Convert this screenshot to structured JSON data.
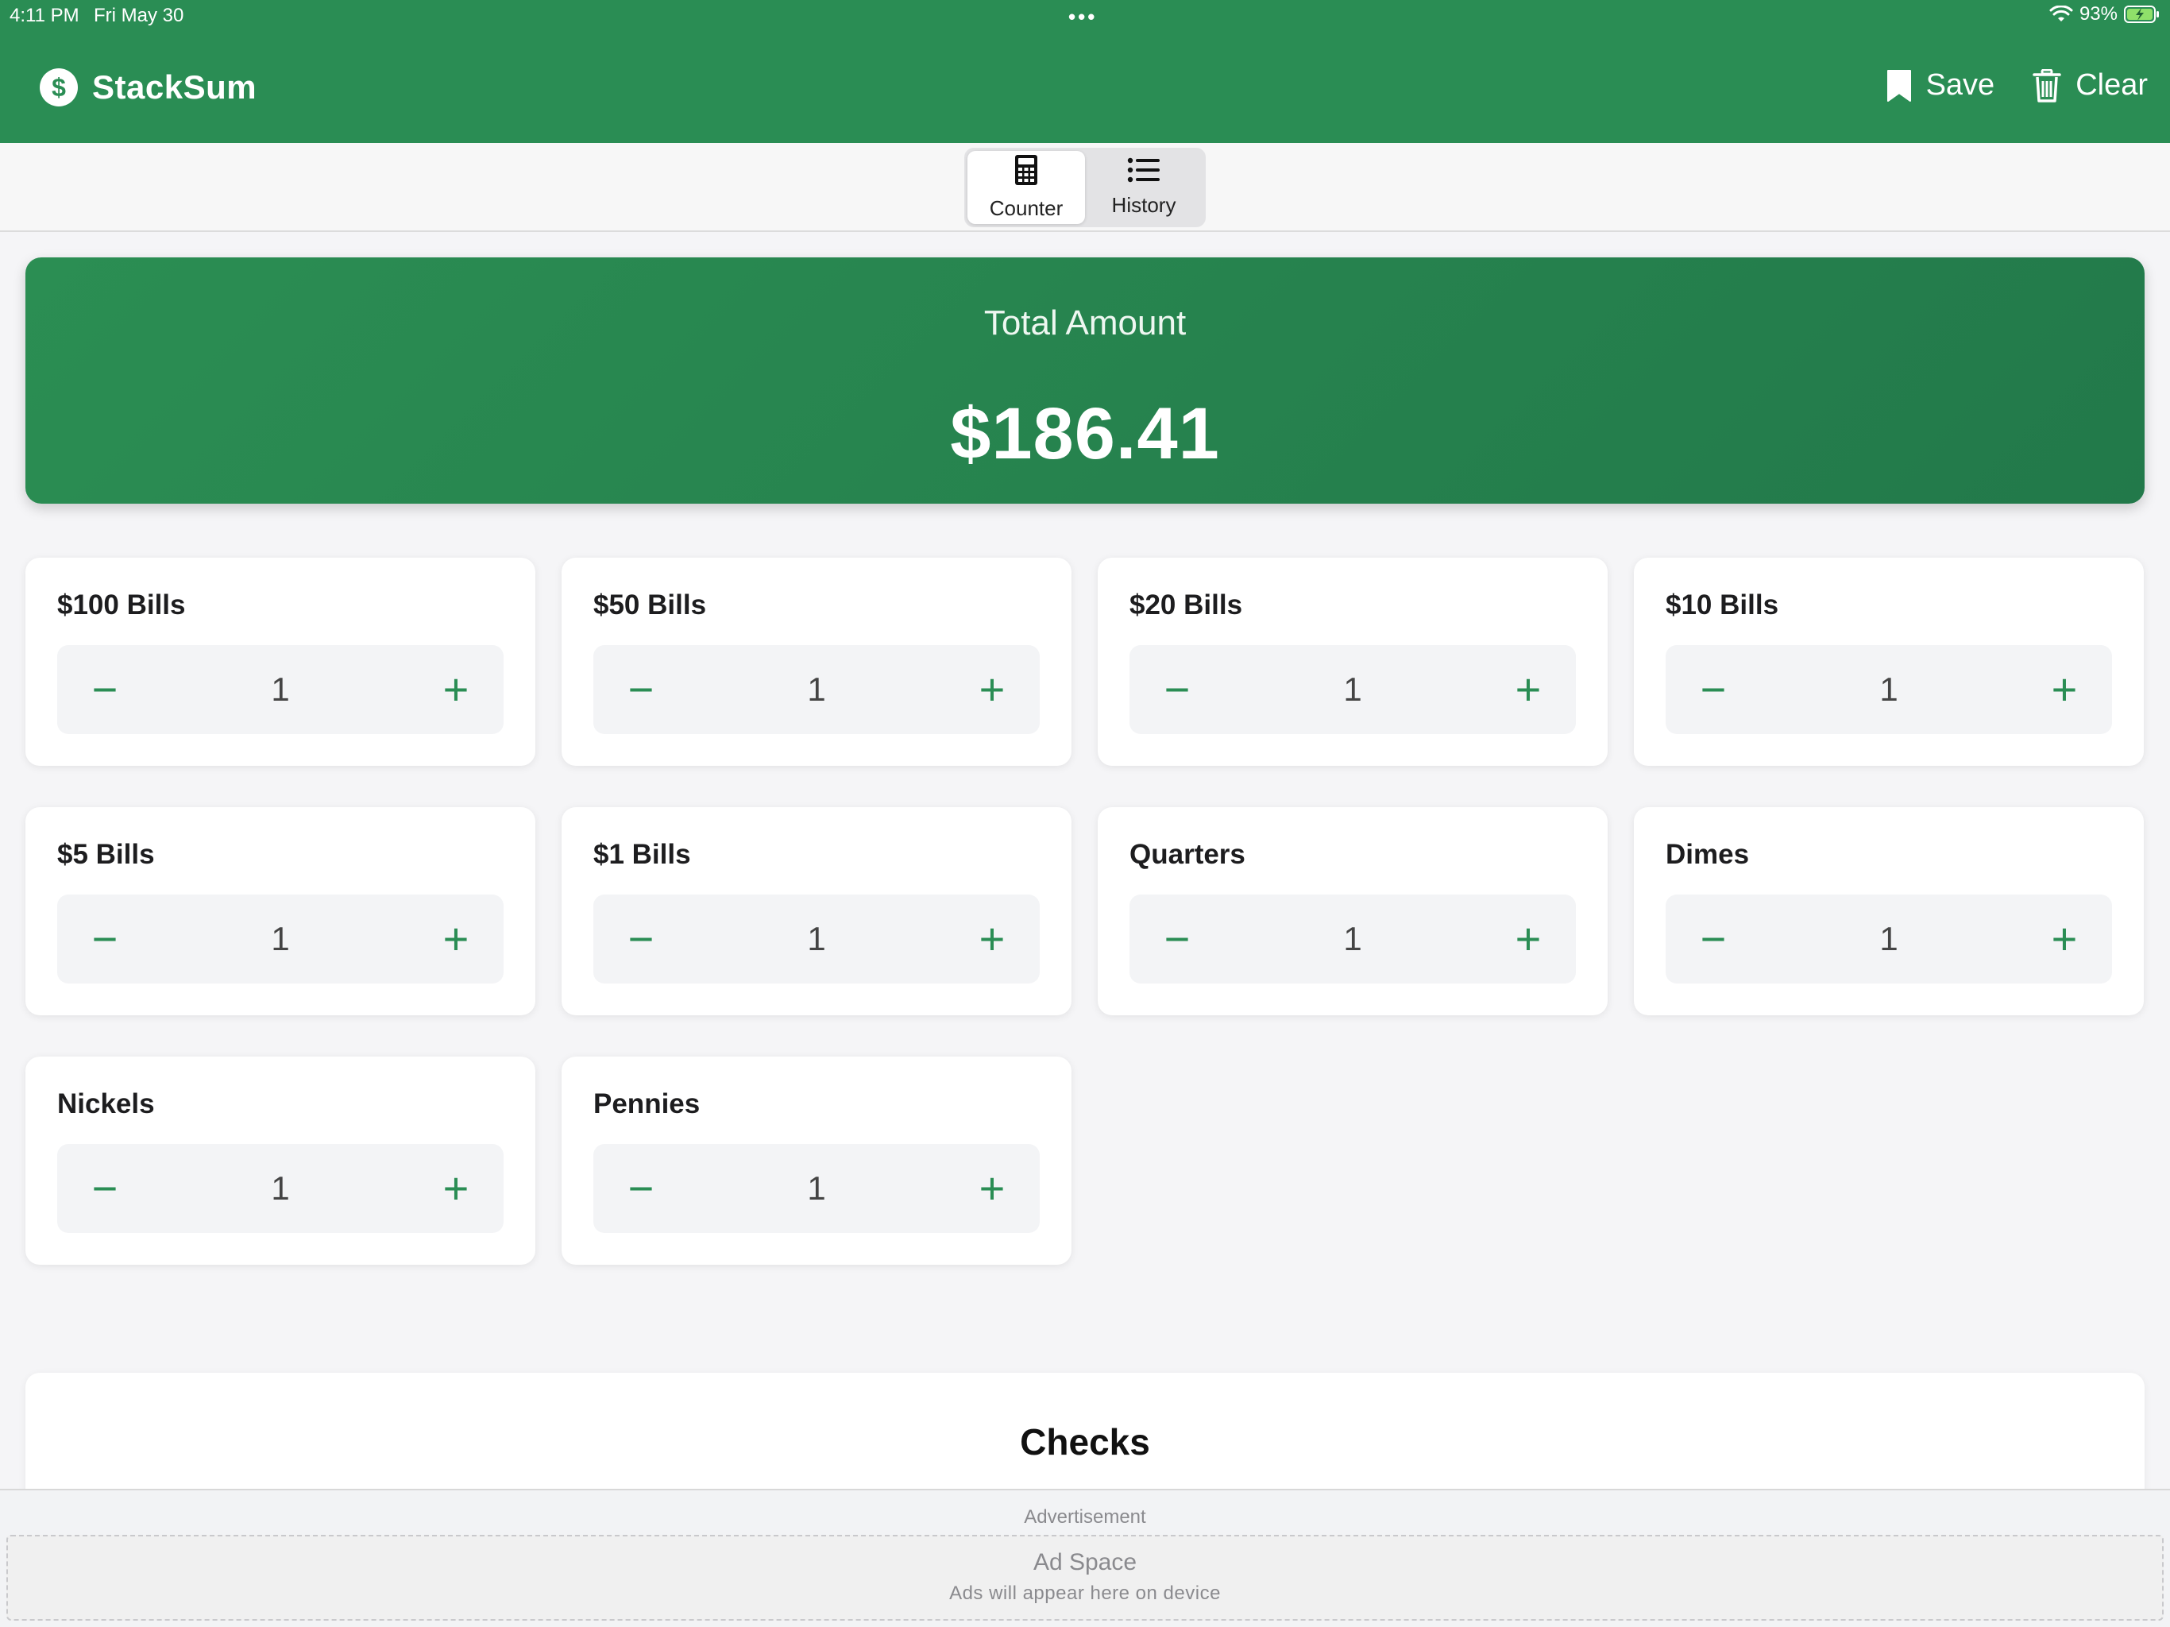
{
  "status_bar": {
    "time": "4:11 PM",
    "date": "Fri May 30",
    "dots": "•••",
    "battery_percent": "93%"
  },
  "header": {
    "app_name": "StackSum",
    "logo_glyph": "$",
    "save_label": "Save",
    "clear_label": "Clear"
  },
  "tabs": [
    {
      "label": "Counter",
      "icon": "calculator-icon",
      "active": true
    },
    {
      "label": "History",
      "icon": "list-icon",
      "active": false
    }
  ],
  "total": {
    "label": "Total Amount",
    "value": "$186.41"
  },
  "denominations": [
    {
      "name": "$100 Bills",
      "count": "1"
    },
    {
      "name": "$50 Bills",
      "count": "1"
    },
    {
      "name": "$20 Bills",
      "count": "1"
    },
    {
      "name": "$10 Bills",
      "count": "1"
    },
    {
      "name": "$5 Bills",
      "count": "1"
    },
    {
      "name": "$1 Bills",
      "count": "1"
    },
    {
      "name": "Quarters",
      "count": "1"
    },
    {
      "name": "Dimes",
      "count": "1"
    },
    {
      "name": "Nickels",
      "count": "1"
    },
    {
      "name": "Pennies",
      "count": "1"
    }
  ],
  "stepper": {
    "minus_glyph": "−",
    "plus_glyph": "+"
  },
  "checks": {
    "title": "Checks"
  },
  "ad": {
    "label": "Advertisement",
    "title": "Ad Space",
    "subtitle": "Ads will appear here on device"
  },
  "colors": {
    "brand_green": "#2a8d54",
    "card_bg": "#ffffff",
    "stepper_bg": "#f3f4f6"
  }
}
